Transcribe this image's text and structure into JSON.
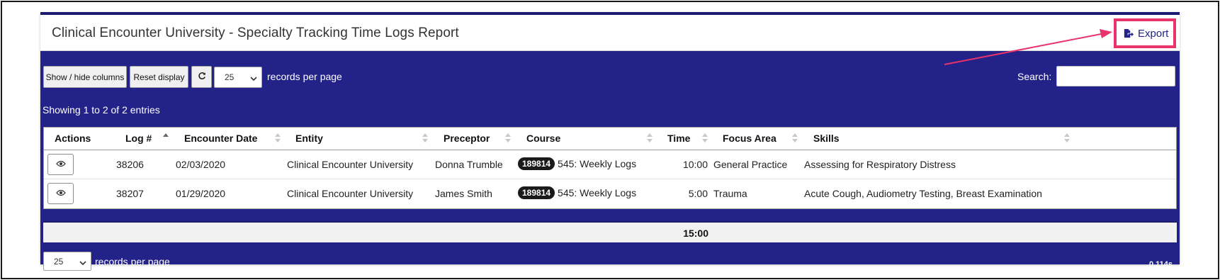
{
  "report": {
    "title": "Clinical Encounter University - Specialty Tracking Time Logs Report",
    "export_label": "Export"
  },
  "toolbar": {
    "show_hide_label": "Show / hide columns",
    "reset_label": "Reset display",
    "refresh_icon": "refresh-icon",
    "page_size": "25",
    "records_per_page_label": "records per page",
    "search_label": "Search:",
    "search_value": ""
  },
  "info": "Showing 1 to 2 of 2 entries",
  "table": {
    "columns": [
      "Actions",
      "Log #",
      "Encounter Date",
      "Entity",
      "Preceptor",
      "Course",
      "Time",
      "Focus Area",
      "Skills"
    ],
    "rows": [
      {
        "log": "38206",
        "date": "02/03/2020",
        "entity": "Clinical Encounter University",
        "preceptor": "Donna Trumble",
        "course_badge": "189814",
        "course": "545: Weekly Logs",
        "time": "10:00",
        "focus": "General Practice",
        "skills": "Assessing for Respiratory Distress"
      },
      {
        "log": "38207",
        "date": "01/29/2020",
        "entity": "Clinical Encounter University",
        "preceptor": "James Smith",
        "course_badge": "189814",
        "course": "545: Weekly Logs",
        "time": "5:00",
        "focus": "Trauma",
        "skills": "Acute Cough, Audiometry Testing, Breast Examination"
      }
    ],
    "total_time": "15:00"
  },
  "footer": {
    "page_size": "25",
    "records_per_page_label": "records per page",
    "timing": "0.114s"
  },
  "colors": {
    "panel": "#222288",
    "highlight": "#e8336b"
  }
}
